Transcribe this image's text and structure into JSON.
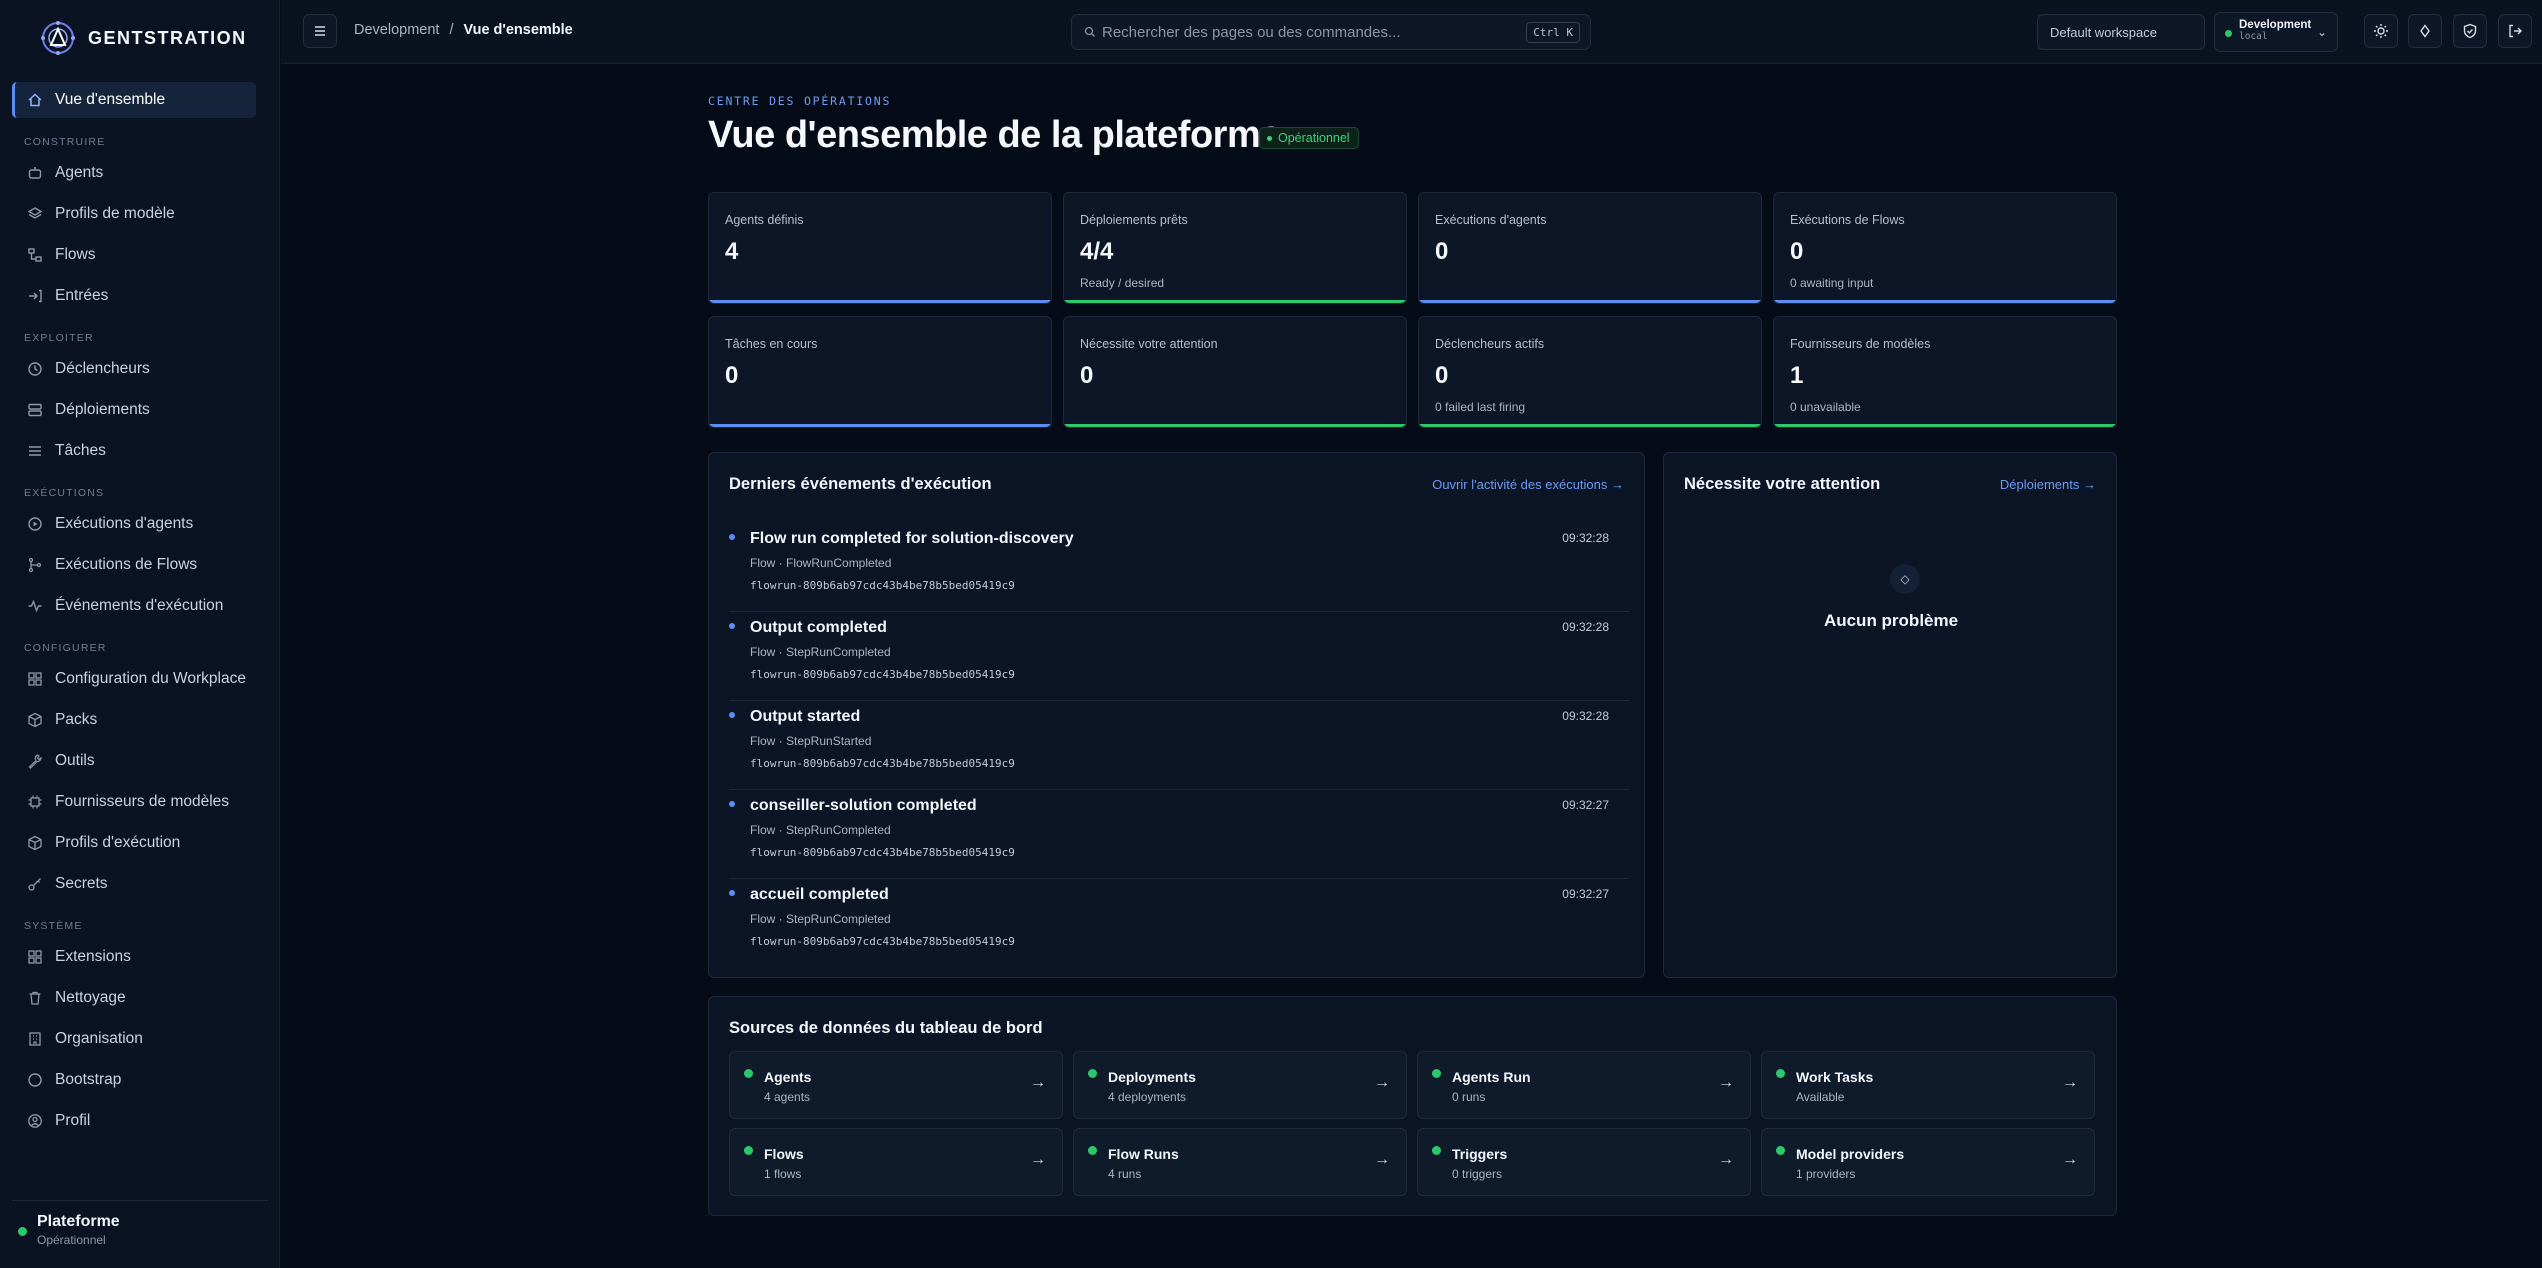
{
  "app": {
    "name": "GENTSTRATION"
  },
  "sidebar": {
    "active": {
      "label": "Vue d'ensemble",
      "icon": "home-icon"
    },
    "sections": [
      {
        "title": "CONSTRUIRE",
        "items": [
          {
            "label": "Agents",
            "icon": "robot-icon"
          },
          {
            "label": "Profils de modèle",
            "icon": "layers-icon"
          },
          {
            "label": "Flows",
            "icon": "flow-icon"
          },
          {
            "label": "Entrées",
            "icon": "login-icon"
          }
        ]
      },
      {
        "title": "EXPLOITER",
        "items": [
          {
            "label": "Déclencheurs",
            "icon": "clock-icon"
          },
          {
            "label": "Déploiements",
            "icon": "server-icon"
          },
          {
            "label": "Tâches",
            "icon": "list-icon"
          }
        ]
      },
      {
        "title": "EXÉCUTIONS",
        "items": [
          {
            "label": "Exécutions d'agents",
            "icon": "play-circle-icon"
          },
          {
            "label": "Exécutions de Flows",
            "icon": "branch-icon"
          },
          {
            "label": "Événements d'exécution",
            "icon": "activity-icon"
          }
        ]
      },
      {
        "title": "CONFIGURER",
        "items": [
          {
            "label": "Configuration du Workplace",
            "icon": "grid-icon"
          },
          {
            "label": "Packs",
            "icon": "package-icon"
          },
          {
            "label": "Outils",
            "icon": "wrench-icon"
          },
          {
            "label": "Fournisseurs de modèles",
            "icon": "chip-icon"
          },
          {
            "label": "Profils d'exécution",
            "icon": "cube-icon"
          },
          {
            "label": "Secrets",
            "icon": "key-icon"
          }
        ]
      },
      {
        "title": "SYSTÈME",
        "items": [
          {
            "label": "Extensions",
            "icon": "puzzle-icon"
          },
          {
            "label": "Nettoyage",
            "icon": "trash-icon"
          },
          {
            "label": "Organisation",
            "icon": "building-icon"
          },
          {
            "label": "Bootstrap",
            "icon": "circle-icon"
          },
          {
            "label": "Profil",
            "icon": "user-icon"
          }
        ]
      }
    ],
    "footer": {
      "title": "Plateforme",
      "status": "Opérationnel",
      "status_color": "#2bc96b"
    }
  },
  "topbar": {
    "breadcrumb": {
      "parent": "Development",
      "separator": "/",
      "current": "Vue d'ensemble"
    },
    "search": {
      "placeholder": "Rechercher des pages ou des commandes...",
      "shortcut": "Ctrl K"
    },
    "workspace": "Default workspace",
    "environment": {
      "name": "Development",
      "sub": "local"
    },
    "actions": [
      "sun-icon",
      "diamond-icon",
      "shield-icon",
      "logout-icon"
    ]
  },
  "header": {
    "eyebrow": "CENTRE DES OPÉRATIONS",
    "title": "Vue d'ensemble de la plateforme",
    "status": "Opérationnel"
  },
  "stats": [
    {
      "label": "Agents définis",
      "value": "4",
      "sub": "",
      "color": "#5b8ef0"
    },
    {
      "label": "Déploiements prêts",
      "value": "4/4",
      "sub": "Ready / desired",
      "color": "#2bc96b"
    },
    {
      "label": "Exécutions d'agents",
      "value": "0",
      "sub": "",
      "color": "#5b8ef0"
    },
    {
      "label": "Exécutions de Flows",
      "value": "0",
      "sub": "0 awaiting input",
      "color": "#5b8ef0"
    },
    {
      "label": "Tâches en cours",
      "value": "0",
      "sub": "",
      "color": "#5b8ef0"
    },
    {
      "label": "Nécessite votre attention",
      "value": "0",
      "sub": "",
      "color": "#2bc96b"
    },
    {
      "label": "Déclencheurs actifs",
      "value": "0",
      "sub": "0 failed last firing",
      "color": "#2bc96b"
    },
    {
      "label": "Fournisseurs de modèles",
      "value": "1",
      "sub": "0 unavailable",
      "color": "#2bc96b"
    }
  ],
  "events_panel": {
    "title": "Derniers événements d'exécution",
    "link": "Ouvrir l'activité des exécutions →",
    "events": [
      {
        "title": "Flow run completed for solution-discovery",
        "meta": "Flow · FlowRunCompleted",
        "id": "flowrun-809b6ab97cdc43b4be78b5bed05419c9",
        "time": "09:32:28"
      },
      {
        "title": "Output completed",
        "meta": "Flow · StepRunCompleted",
        "id": "flowrun-809b6ab97cdc43b4be78b5bed05419c9",
        "time": "09:32:28"
      },
      {
        "title": "Output started",
        "meta": "Flow · StepRunStarted",
        "id": "flowrun-809b6ab97cdc43b4be78b5bed05419c9",
        "time": "09:32:28"
      },
      {
        "title": "conseiller-solution completed",
        "meta": "Flow · StepRunCompleted",
        "id": "flowrun-809b6ab97cdc43b4be78b5bed05419c9",
        "time": "09:32:27"
      },
      {
        "title": "accueil completed",
        "meta": "Flow · StepRunCompleted",
        "id": "flowrun-809b6ab97cdc43b4be78b5bed05419c9",
        "time": "09:32:27"
      }
    ]
  },
  "attention_panel": {
    "title": "Nécessite votre attention",
    "link": "Déploiements →",
    "empty_text": "Aucun problème"
  },
  "sources_panel": {
    "title": "Sources de données du tableau de bord",
    "sources": [
      {
        "name": "Agents",
        "count": "4 agents"
      },
      {
        "name": "Deployments",
        "count": "4 deployments"
      },
      {
        "name": "Agents Run",
        "count": "0 runs"
      },
      {
        "name": "Work Tasks",
        "count": "Available"
      },
      {
        "name": "Flows",
        "count": "1 flows"
      },
      {
        "name": "Flow Runs",
        "count": "4 runs"
      },
      {
        "name": "Triggers",
        "count": "0 triggers"
      },
      {
        "name": "Model providers",
        "count": "1 providers"
      }
    ],
    "arrow": "→"
  }
}
